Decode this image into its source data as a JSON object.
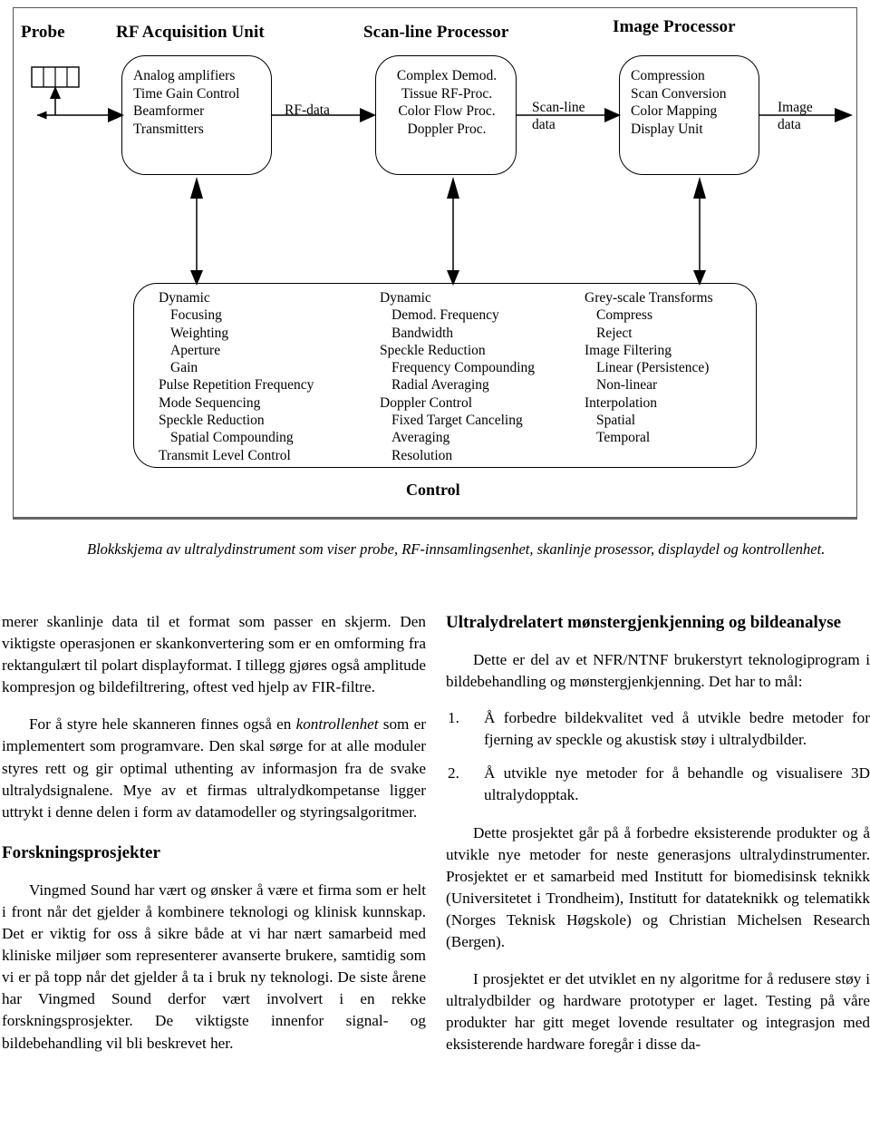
{
  "figure": {
    "titles": {
      "probe": "Probe",
      "rf_acquisition": "RF Acquisition Unit",
      "scanline_processor": "Scan-line Processor",
      "image_processor": "Image Processor"
    },
    "boxes": {
      "rf_acquisition": "Analog amplifiers\nTime Gain Control\nBeamformer\nTransmitters",
      "scanline_processor": "Complex Demod.\nTissue RF-Proc.\nColor Flow Proc.\nDoppler Proc.",
      "image_processor": "Compression\nScan Conversion\nColor Mapping\nDisplay Unit"
    },
    "arrow_labels": {
      "rf_data": "RF-data",
      "scanline_data": "Scan-line\ndata",
      "image_data": "Image\ndata"
    },
    "control_label": "Control",
    "control_columns": [
      {
        "name": "acquisition-controls",
        "items": [
          {
            "text": "Dynamic",
            "sub": false
          },
          {
            "text": "Focusing",
            "sub": true
          },
          {
            "text": "Weighting",
            "sub": true
          },
          {
            "text": "Aperture",
            "sub": true
          },
          {
            "text": "Gain",
            "sub": true
          },
          {
            "text": "Pulse Repetition Frequency",
            "sub": false
          },
          {
            "text": "Mode Sequencing",
            "sub": false
          },
          {
            "text": "Speckle Reduction",
            "sub": false
          },
          {
            "text": "Spatial Compounding",
            "sub": true
          },
          {
            "text": "Transmit Level Control",
            "sub": false
          }
        ]
      },
      {
        "name": "scanline-controls",
        "items": [
          {
            "text": "Dynamic",
            "sub": false
          },
          {
            "text": "Demod. Frequency",
            "sub": true
          },
          {
            "text": "Bandwidth",
            "sub": true
          },
          {
            "text": "Speckle Reduction",
            "sub": false
          },
          {
            "text": "Frequency Compounding",
            "sub": true
          },
          {
            "text": "Radial Averaging",
            "sub": true
          },
          {
            "text": "Doppler Control",
            "sub": false
          },
          {
            "text": "Fixed Target Canceling",
            "sub": true
          },
          {
            "text": "Averaging",
            "sub": true
          },
          {
            "text": "Resolution",
            "sub": true
          }
        ]
      },
      {
        "name": "image-controls",
        "items": [
          {
            "text": "Grey-scale Transforms",
            "sub": false
          },
          {
            "text": "Compress",
            "sub": true
          },
          {
            "text": "Reject",
            "sub": true
          },
          {
            "text": "Image Filtering",
            "sub": false
          },
          {
            "text": "Linear (Persistence)",
            "sub": true
          },
          {
            "text": "Non-linear",
            "sub": true
          },
          {
            "text": "Interpolation",
            "sub": false
          },
          {
            "text": "Spatial",
            "sub": true
          },
          {
            "text": "Temporal",
            "sub": true
          }
        ]
      }
    ]
  },
  "caption": "Blokkskjema av ultralydinstrument som viser probe, RF-innsamlingsenhet, skanlinje prosessor, displaydel og kontrollenhet.",
  "left_column": {
    "para1": "merer skanlinje data til et format som passer en skjerm. Den viktigste operasjonen er skankonvertering som er en omforming fra rektangulært til polart displayformat. I tillegg gjøres også amplitude kompresjon og bildefiltrering, oftest ved hjelp av FIR-filtre.",
    "para2_before": "For å styre hele skanneren finnes også en ",
    "para2_italic": "kontrollenhet",
    "para2_after": " som er implementert som programvare. Den skal sørge for at alle moduler styres rett og gir optimal uthenting av informasjon fra de svake ultralydsignalene. Mye av et firmas ultralydkompetanse ligger uttrykt i denne delen i form av datamodeller og styringsalgoritmer.",
    "heading": "Forskningsprosjekter",
    "para3": "Vingmed Sound har vært og ønsker å være et firma som er helt i front når det gjelder å kombinere teknologi og klinisk kunnskap. Det er viktig for oss å sikre både at vi har nært samarbeid med kliniske miljøer som representerer avanserte brukere, samtidig som vi er på topp når det gjelder å ta i bruk ny teknologi. De siste årene har Vingmed Sound derfor vært involvert i en rekke forskningsprosjekter. De viktigste innenfor signal- og bildebehandling vil bli beskrevet her."
  },
  "right_column": {
    "heading": "Ultralydrelatert mønstergjenkjenning og bildeanalyse",
    "para1": "Dette er del av et NFR/NTNF brukerstyrt teknologiprogram i bildebehandling og mønstergjenkjenning. Det har to mål:",
    "goals": [
      {
        "num": "1.",
        "text": "Å forbedre bildekvalitet ved å utvikle bedre metoder for fjerning av speckle og akustisk støy i ultralydbilder."
      },
      {
        "num": "2.",
        "text": "Å utvikle nye metoder for å behandle og visualisere 3D ultralydopptak."
      }
    ],
    "para2": "Dette prosjektet går på å forbedre eksisterende produkter og å utvikle nye metoder for neste generasjons ultralydinstrumenter. Prosjektet er et samarbeid med Institutt for biomedisinsk teknikk (Universitetet i Trondheim), Institutt for datateknikk og telematikk (Norges Teknisk Høgskole) og Christian Michelsen Research (Bergen).",
    "para3": "I prosjektet er det utviklet en ny algoritme for å redusere støy i ultralydbilder og hardware prototyper er laget. Testing på våre produkter har gitt meget lovende resultater og integrasjon med eksisterende hardware foregår i disse da-"
  }
}
